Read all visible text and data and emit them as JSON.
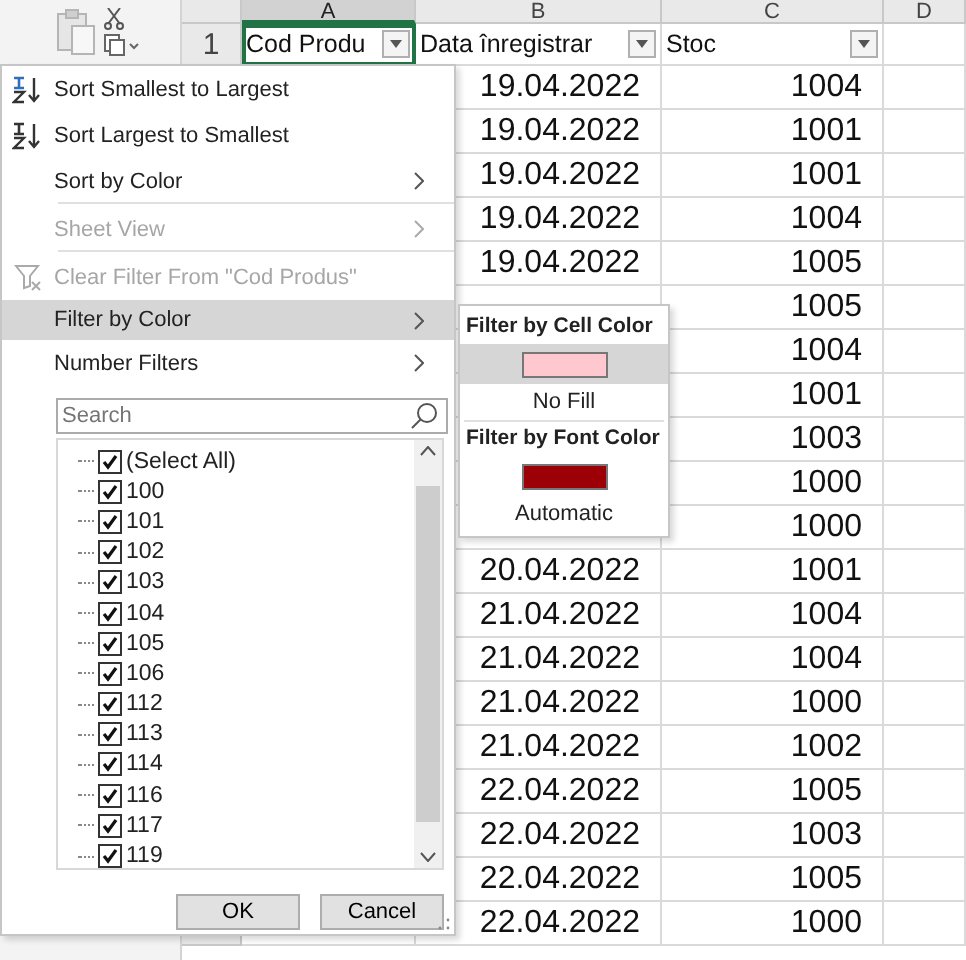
{
  "sheet": {
    "column_headers": [
      {
        "label": "A",
        "selected": true
      },
      {
        "label": "B",
        "selected": false
      },
      {
        "label": "C",
        "selected": false
      },
      {
        "label": "D",
        "selected": false
      }
    ],
    "header_row": {
      "row_number": "1",
      "cells": [
        {
          "text": "Cod Produ",
          "selected": true
        },
        {
          "text": "Data înregistrar",
          "selected": false
        },
        {
          "text": "Stoc",
          "selected": false
        }
      ]
    },
    "rows": [
      {
        "date": "19.04.2022",
        "stock": "1004"
      },
      {
        "date": "19.04.2022",
        "stock": "1001"
      },
      {
        "date": "19.04.2022",
        "stock": "1001"
      },
      {
        "date": "19.04.2022",
        "stock": "1004"
      },
      {
        "date": "19.04.2022",
        "stock": "1005"
      },
      {
        "stock": "1005"
      },
      {
        "stock": "1004"
      },
      {
        "stock": "1001"
      },
      {
        "stock": "1003"
      },
      {
        "stock": "1000"
      },
      {
        "stock": "1000"
      },
      {
        "date": "20.04.2022",
        "stock": "1001"
      },
      {
        "date": "21.04.2022",
        "stock": "1004"
      },
      {
        "date": "21.04.2022",
        "stock": "1004"
      },
      {
        "date": "21.04.2022",
        "stock": "1000"
      },
      {
        "date": "21.04.2022",
        "stock": "1002"
      },
      {
        "date": "22.04.2022",
        "stock": "1005"
      },
      {
        "date": "22.04.2022",
        "stock": "1003"
      },
      {
        "date": "22.04.2022",
        "stock": "1005"
      },
      {
        "date": "22.04.2022",
        "stock": "1000"
      }
    ]
  },
  "filter_menu": {
    "items": [
      {
        "label": "Sort Smallest to Largest",
        "kind": "sort-asc",
        "disabled": false,
        "selected": false,
        "submenu": false,
        "separator_after": false
      },
      {
        "label": "Sort Largest to Smallest",
        "kind": "sort-desc",
        "disabled": false,
        "selected": false,
        "submenu": false,
        "separator_after": false
      },
      {
        "label": "Sort by Color",
        "kind": "plain",
        "disabled": false,
        "selected": false,
        "submenu": true,
        "separator_after": true
      },
      {
        "label": "Sheet View",
        "kind": "plain",
        "disabled": true,
        "selected": false,
        "submenu": true,
        "separator_after": true
      },
      {
        "label": "Clear Filter From \"Cod Produs\"",
        "kind": "clear-filter",
        "disabled": true,
        "selected": false,
        "submenu": false,
        "separator_after": false
      },
      {
        "label": "Filter by Color",
        "kind": "plain",
        "disabled": false,
        "selected": true,
        "submenu": true,
        "separator_after": false
      },
      {
        "label": "Number Filters",
        "kind": "plain",
        "disabled": false,
        "selected": false,
        "submenu": true,
        "separator_after": false
      }
    ],
    "search": {
      "placeholder": "Search"
    },
    "values": [
      {
        "label": "(Select All)",
        "checked": true
      },
      {
        "label": "100",
        "checked": true
      },
      {
        "label": "101",
        "checked": true
      },
      {
        "label": "102",
        "checked": true
      },
      {
        "label": "103",
        "checked": true
      },
      {
        "label": "104",
        "checked": true
      },
      {
        "label": "105",
        "checked": true
      },
      {
        "label": "106",
        "checked": true
      },
      {
        "label": "112",
        "checked": true
      },
      {
        "label": "113",
        "checked": true
      },
      {
        "label": "114",
        "checked": true
      },
      {
        "label": "116",
        "checked": true
      },
      {
        "label": "117",
        "checked": true
      },
      {
        "label": "119",
        "checked": true
      }
    ],
    "buttons": [
      "OK",
      "Cancel"
    ]
  },
  "color_submenu": {
    "sections": [
      {
        "heading": "Filter by Cell Color",
        "swatch": {
          "color": "#ffc7ce",
          "selected": true
        },
        "option": "No Fill"
      },
      {
        "heading": "Filter by Font Color",
        "swatch": {
          "color": "#9c0006",
          "selected": false
        },
        "option": "Automatic"
      }
    ]
  }
}
